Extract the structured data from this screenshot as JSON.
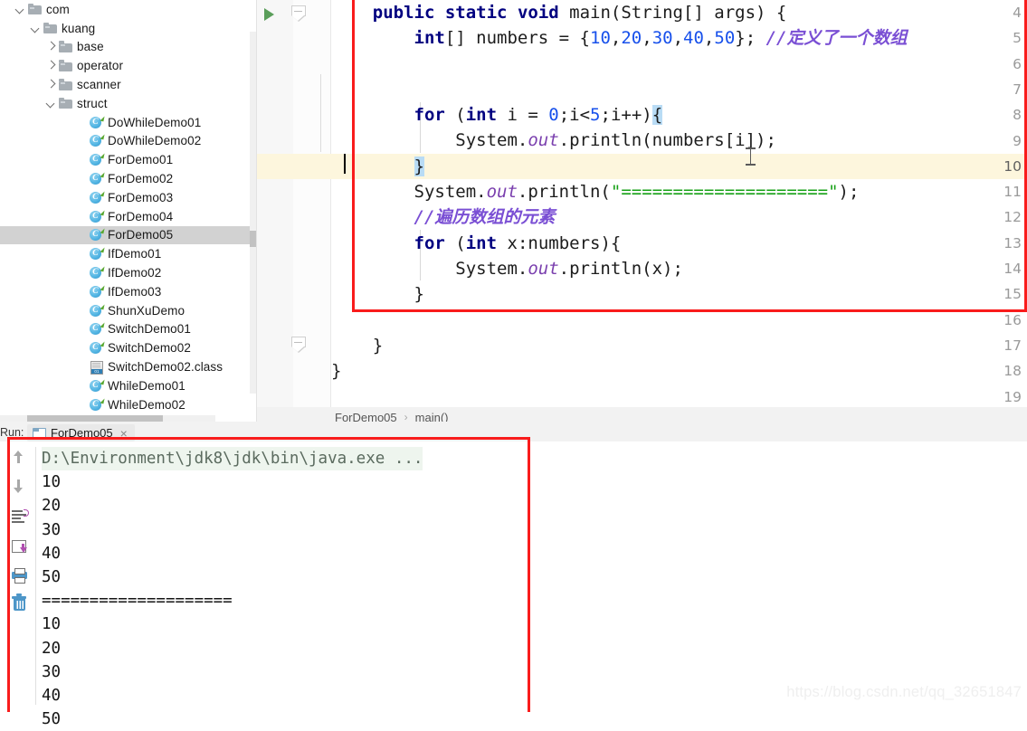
{
  "project_tree": {
    "name": "project-file-tree",
    "items": [
      {
        "label": "com",
        "indent": 0,
        "twisty": "down",
        "icon": "folder-icon",
        "selected": false
      },
      {
        "label": "kuang",
        "indent": 1,
        "twisty": "down",
        "icon": "folder-icon",
        "selected": false
      },
      {
        "label": "base",
        "indent": 2,
        "twisty": "right",
        "icon": "folder-icon",
        "selected": false
      },
      {
        "label": "operator",
        "indent": 2,
        "twisty": "right",
        "icon": "folder-icon",
        "selected": false
      },
      {
        "label": "scanner",
        "indent": 2,
        "twisty": "right",
        "icon": "folder-icon",
        "selected": false
      },
      {
        "label": "struct",
        "indent": 2,
        "twisty": "down",
        "icon": "folder-icon",
        "selected": false
      },
      {
        "label": "DoWhileDemo01",
        "indent": 4,
        "twisty": "none",
        "icon": "java-class-icon",
        "selected": false
      },
      {
        "label": "DoWhileDemo02",
        "indent": 4,
        "twisty": "none",
        "icon": "java-class-icon",
        "selected": false
      },
      {
        "label": "ForDemo01",
        "indent": 4,
        "twisty": "none",
        "icon": "java-class-icon",
        "selected": false
      },
      {
        "label": "ForDemo02",
        "indent": 4,
        "twisty": "none",
        "icon": "java-class-icon",
        "selected": false
      },
      {
        "label": "ForDemo03",
        "indent": 4,
        "twisty": "none",
        "icon": "java-class-icon",
        "selected": false
      },
      {
        "label": "ForDemo04",
        "indent": 4,
        "twisty": "none",
        "icon": "java-class-icon",
        "selected": false
      },
      {
        "label": "ForDemo05",
        "indent": 4,
        "twisty": "none",
        "icon": "java-class-icon",
        "selected": true
      },
      {
        "label": "IfDemo01",
        "indent": 4,
        "twisty": "none",
        "icon": "java-class-icon",
        "selected": false
      },
      {
        "label": "IfDemo02",
        "indent": 4,
        "twisty": "none",
        "icon": "java-class-icon",
        "selected": false
      },
      {
        "label": "IfDemo03",
        "indent": 4,
        "twisty": "none",
        "icon": "java-class-icon",
        "selected": false
      },
      {
        "label": "ShunXuDemo",
        "indent": 4,
        "twisty": "none",
        "icon": "java-class-icon",
        "selected": false
      },
      {
        "label": "SwitchDemo01",
        "indent": 4,
        "twisty": "none",
        "icon": "java-class-icon",
        "selected": false
      },
      {
        "label": "SwitchDemo02",
        "indent": 4,
        "twisty": "none",
        "icon": "java-class-icon",
        "selected": false
      },
      {
        "label": "SwitchDemo02.class",
        "indent": 4,
        "twisty": "none",
        "icon": "compiled-class-icon",
        "selected": false
      },
      {
        "label": "WhileDemo01",
        "indent": 4,
        "twisty": "none",
        "icon": "java-class-icon",
        "selected": false
      },
      {
        "label": "WhileDemo02",
        "indent": 4,
        "twisty": "none",
        "icon": "java-class-icon",
        "selected": false
      }
    ]
  },
  "editor": {
    "first_visible_line": 4,
    "last_visible_line": 19,
    "current_line": 10,
    "line_numbers": [
      4,
      5,
      6,
      7,
      8,
      9,
      10,
      11,
      12,
      13,
      14,
      15,
      16,
      17,
      18,
      19
    ],
    "code_lines": [
      {
        "n": 4,
        "text": "    public static void main(String[] args) {"
      },
      {
        "n": 5,
        "text": "        int[] numbers = {10,20,30,40,50}; //定义了一个数组"
      },
      {
        "n": 6,
        "text": ""
      },
      {
        "n": 7,
        "text": ""
      },
      {
        "n": 8,
        "text": "        for (int i = 0;i<5;i++){"
      },
      {
        "n": 9,
        "text": "            System.out.println(numbers[i]);"
      },
      {
        "n": 10,
        "text": "        }"
      },
      {
        "n": 11,
        "text": "        System.out.println(\"====================\");"
      },
      {
        "n": 12,
        "text": "        //遍历数组的元素"
      },
      {
        "n": 13,
        "text": "        for (int x:numbers){"
      },
      {
        "n": 14,
        "text": "            System.out.println(x);"
      },
      {
        "n": 15,
        "text": "        }"
      },
      {
        "n": 16,
        "text": ""
      },
      {
        "n": 17,
        "text": "    }"
      },
      {
        "n": 18,
        "text": "}"
      },
      {
        "n": 19,
        "text": ""
      }
    ],
    "inline_comments": [
      "//定义了一个数组",
      "//遍历数组的元素"
    ],
    "string_literal": "====================",
    "array_values": [
      10,
      20,
      30,
      40,
      50
    ],
    "loop_bound": 5,
    "gutter": {
      "run_arrow_line": 4,
      "fold_marker_lines": [
        4,
        17
      ]
    },
    "colors": {
      "keyword": "#000080",
      "number": "#1750eb",
      "string": "#15a015",
      "comment": "#7a4fd4",
      "static_field": "#7a3fae",
      "current_line_bg": "#fdf6dd",
      "brace_match_bg": "#b9dcf5"
    }
  },
  "breadcrumb": {
    "name": "editor-breadcrumb",
    "items": [
      "ForDemo05",
      "main()"
    ],
    "separator": "›"
  },
  "run_panel": {
    "label": "Run:",
    "tab": {
      "title": "ForDemo05",
      "close": "×"
    },
    "toolbar_icons": [
      "scroll-up-icon",
      "scroll-down-icon",
      "soft-wrap-icon",
      "export-output-icon",
      "print-icon",
      "clear-all-icon"
    ],
    "console_lines": [
      {
        "text": "D:\\Environment\\jdk8\\jdk\\bin\\java.exe ...",
        "kind": "path"
      },
      {
        "text": "10",
        "kind": "out"
      },
      {
        "text": "20",
        "kind": "out"
      },
      {
        "text": "30",
        "kind": "out"
      },
      {
        "text": "40",
        "kind": "out"
      },
      {
        "text": "50",
        "kind": "out"
      },
      {
        "text": "====================",
        "kind": "out"
      },
      {
        "text": "10",
        "kind": "out"
      },
      {
        "text": "20",
        "kind": "out"
      },
      {
        "text": "30",
        "kind": "out"
      },
      {
        "text": "40",
        "kind": "out"
      },
      {
        "text": "50",
        "kind": "out"
      }
    ]
  },
  "annotations": {
    "box_color": "#f91c1c",
    "boxes": [
      "code-region-highlight",
      "console-region-highlight"
    ]
  },
  "watermark": {
    "text": "https://blog.csdn.net/qq_32651847"
  }
}
